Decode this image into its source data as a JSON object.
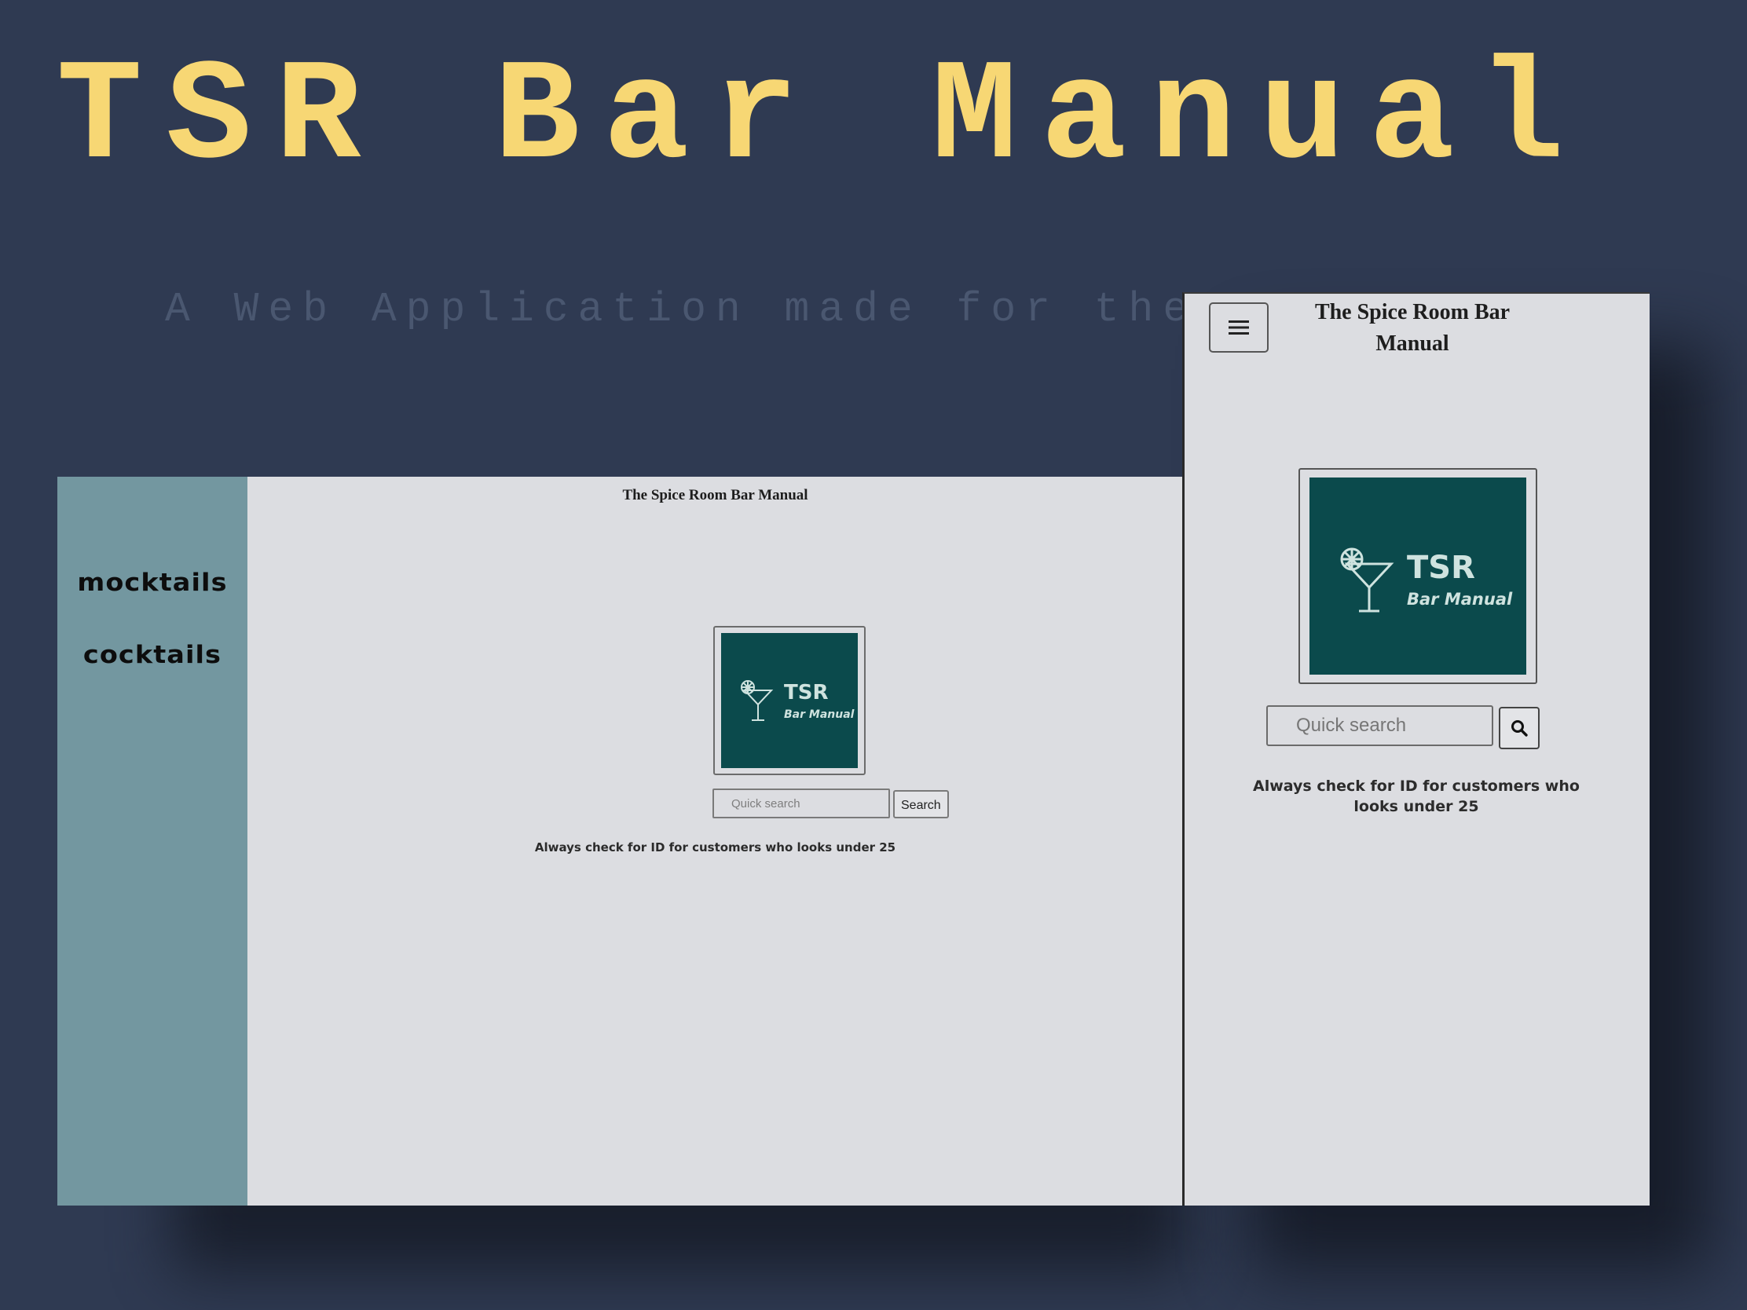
{
  "hero": {
    "title": "TSR Bar Manual",
    "subtitle": "A Web Application made for the Bar"
  },
  "colors": {
    "background": "#2f3a52",
    "title": "#f7d774",
    "subtitle": "#4a5770",
    "sidebar": "#7397a0",
    "page": "#dcdde1",
    "logo_background": "#0b4a4c",
    "logo_text": "#cfe3df"
  },
  "desktop": {
    "header": "The Spice Room Bar Manual",
    "sidebar": {
      "items": [
        {
          "label": "mocktails"
        },
        {
          "label": "cocktails"
        }
      ]
    },
    "logo": {
      "text": "TSR",
      "script": "Bar Manual",
      "icon": "cocktail-glass-icon"
    },
    "search": {
      "placeholder": "Quick search",
      "button_label": "Search"
    },
    "notice": "Always check for ID for customers who looks under 25"
  },
  "mobile": {
    "header": "The Spice Room Bar Manual",
    "menu_icon": "hamburger-menu-icon",
    "logo": {
      "text": "TSR",
      "script": "Bar Manual",
      "icon": "cocktail-glass-icon"
    },
    "search": {
      "placeholder": "Quick search",
      "button_icon": "search-icon"
    },
    "notice": "Always check for ID for customers who looks under 25"
  }
}
